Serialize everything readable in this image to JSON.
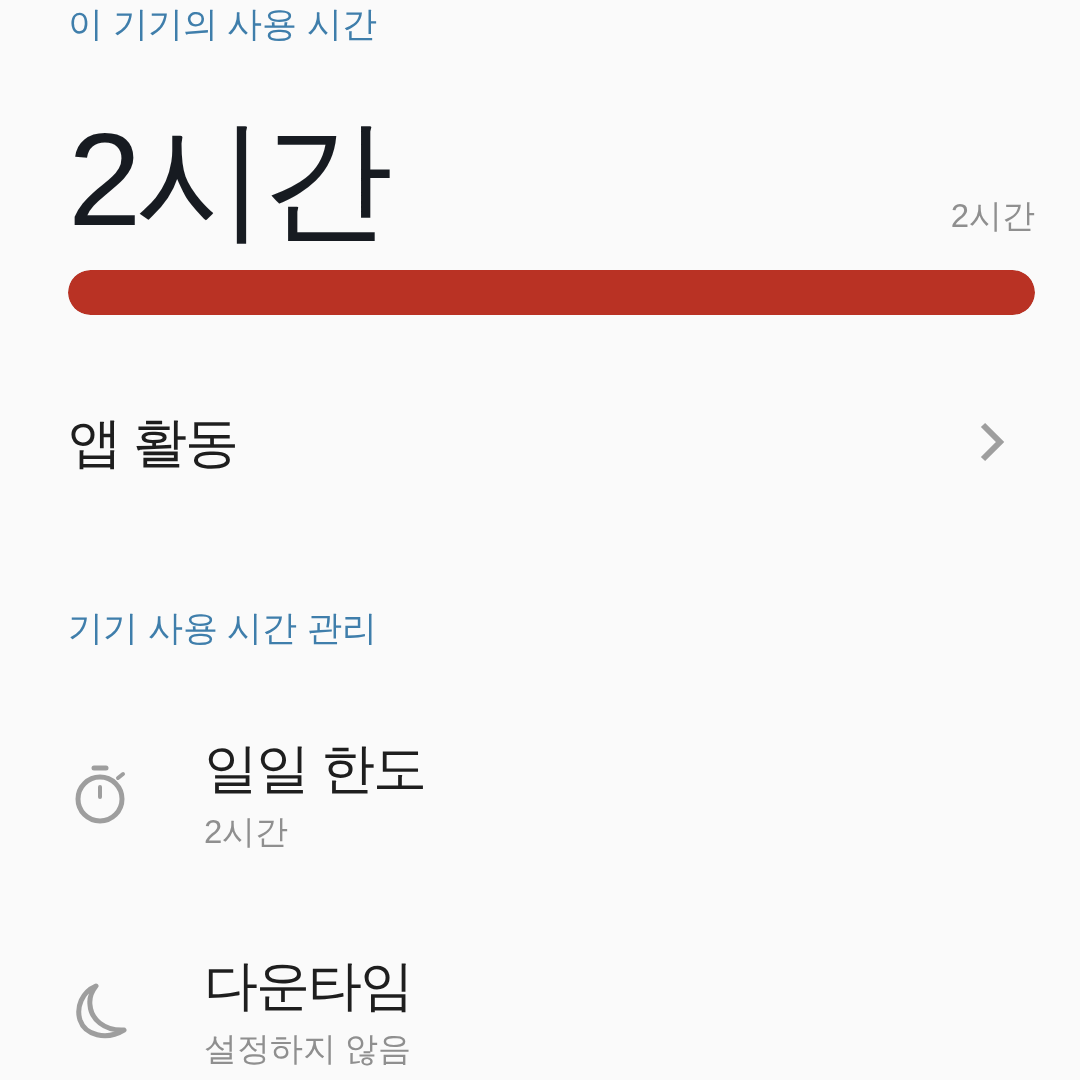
{
  "usage": {
    "title": "이 기기의 사용 시간",
    "total": "2시간",
    "limit_label": "2시간",
    "bar": {
      "level": 1
    }
  },
  "app_activity": {
    "label": "앱 활동"
  },
  "management": {
    "title": "기기 사용 시간 관리",
    "items": [
      {
        "kind": "timer",
        "title": "일일 한도",
        "subtitle": "2시간"
      },
      {
        "kind": "downtime",
        "title": "다운타임",
        "subtitle": "설정하지 않음"
      }
    ]
  }
}
